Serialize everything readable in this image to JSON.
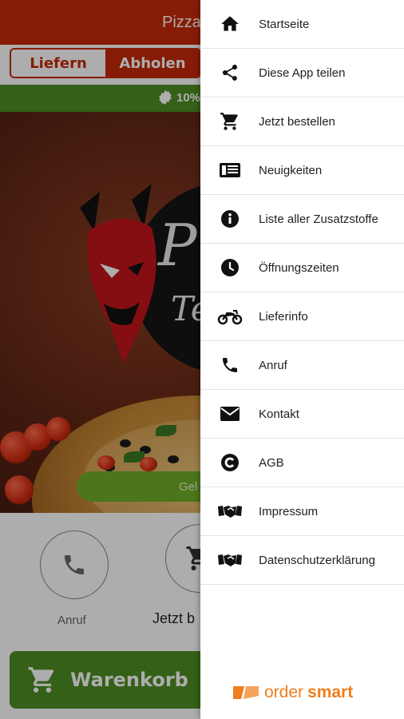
{
  "app": {
    "title": "Pizza",
    "toggle": {
      "option1": "Liefern",
      "option2": "Abholen"
    },
    "promo_text": "10%",
    "hero_logo": {
      "big_letter": "P",
      "small_letters": "Te"
    },
    "green_button_text": "Gel",
    "circle_buttons": [
      {
        "label": "Anruf"
      },
      {
        "label": "Jetzt b"
      }
    ],
    "cart_label": "Warenkorb",
    "colors": {
      "header": "#c62a09",
      "green": "#4f8e22",
      "accent": "#6fae28"
    }
  },
  "drawer": {
    "items": [
      {
        "label": "Startseite",
        "icon": "home-icon"
      },
      {
        "label": "Diese App teilen",
        "icon": "share-icon"
      },
      {
        "label": "Jetzt bestellen",
        "icon": "cart-icon"
      },
      {
        "label": "Neuigkeiten",
        "icon": "news-icon"
      },
      {
        "label": "Liste aller Zusatzstoffe",
        "icon": "info-icon"
      },
      {
        "label": "Öffnungszeiten",
        "icon": "clock-icon"
      },
      {
        "label": "Lieferinfo",
        "icon": "motorcycle-icon"
      },
      {
        "label": "Anruf",
        "icon": "phone-icon"
      },
      {
        "label": "Kontakt",
        "icon": "mail-icon"
      },
      {
        "label": "AGB",
        "icon": "copyright-icon"
      },
      {
        "label": "Impressum",
        "icon": "handshake-icon"
      },
      {
        "label": "Datenschutzerklärung",
        "icon": "handshake-icon"
      }
    ],
    "brand": {
      "part1": "order",
      "part2": "smart",
      "color": "#f07d1e"
    }
  }
}
